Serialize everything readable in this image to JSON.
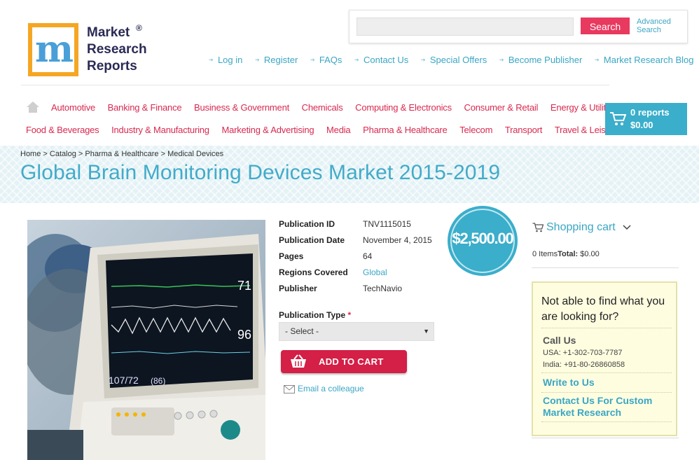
{
  "logo": {
    "line1": "Market",
    "line2": "Research",
    "line3": "Reports",
    "reg": "®"
  },
  "search": {
    "placeholder": "",
    "button": "Search",
    "advanced_line1": "Advanced",
    "advanced_line2": "Search"
  },
  "top_links": [
    "Log in",
    "Register",
    "FAQs",
    "Contact Us",
    "Special Offers",
    "Become Publisher",
    "Market Research Blog"
  ],
  "nav_row1": [
    "Automotive",
    "Banking & Finance",
    "Business & Government",
    "Chemicals",
    "Computing & Electronics",
    "Consumer & Retail",
    "Energy & Utilities"
  ],
  "nav_row2": [
    "Food & Beverages",
    "Industry & Manufacturing",
    "Marketing & Advertising",
    "Media",
    "Pharma & Healthcare",
    "Telecom",
    "Transport",
    "Travel & Leisure"
  ],
  "cart_widget": {
    "count": "0 reports",
    "total": "$0.00"
  },
  "breadcrumb": {
    "home": "Home",
    "catalog": "Catalog",
    "category": "Pharma & Healthcare",
    "current": "Medical Devices",
    "sep": " > "
  },
  "page_title": "Global Brain Monitoring Devices Market 2015-2019",
  "details": [
    {
      "label": "Publication ID",
      "value": "TNV1115015"
    },
    {
      "label": "Publication Date",
      "value": "November 4, 2015"
    },
    {
      "label": "Pages",
      "value": "64"
    },
    {
      "label": "Regions Covered",
      "value": "Global"
    },
    {
      "label": "Publisher",
      "value": "TechNavio"
    }
  ],
  "publication_type": {
    "label": "Publication Type",
    "required": "*",
    "selected": "- Select -"
  },
  "add_to_cart": "ADD TO CART",
  "email_colleague": "Email a colleague",
  "price": "$2,500.00",
  "shopping_cart": {
    "title": "Shopping cart",
    "items": "0 Items",
    "total_label": "Total:",
    "total_value": "$0.00"
  },
  "help_box": {
    "question": "Not able to find what you are looking for?",
    "call_us": "Call Us",
    "usa": "USA: +1-302-703-7787",
    "india": "India: +91-80-26860858",
    "write": "Write to Us",
    "custom": "Contact Us For Custom Market Research"
  },
  "monitor": {
    "hr": "71",
    "spo2": "96",
    "bp": "107/72",
    "map": "(86)"
  },
  "colors": {
    "accent_pink": "#d8294f",
    "accent_blue": "#3aaecb",
    "button_red": "#d41f46",
    "search_pink": "#e8395f"
  }
}
